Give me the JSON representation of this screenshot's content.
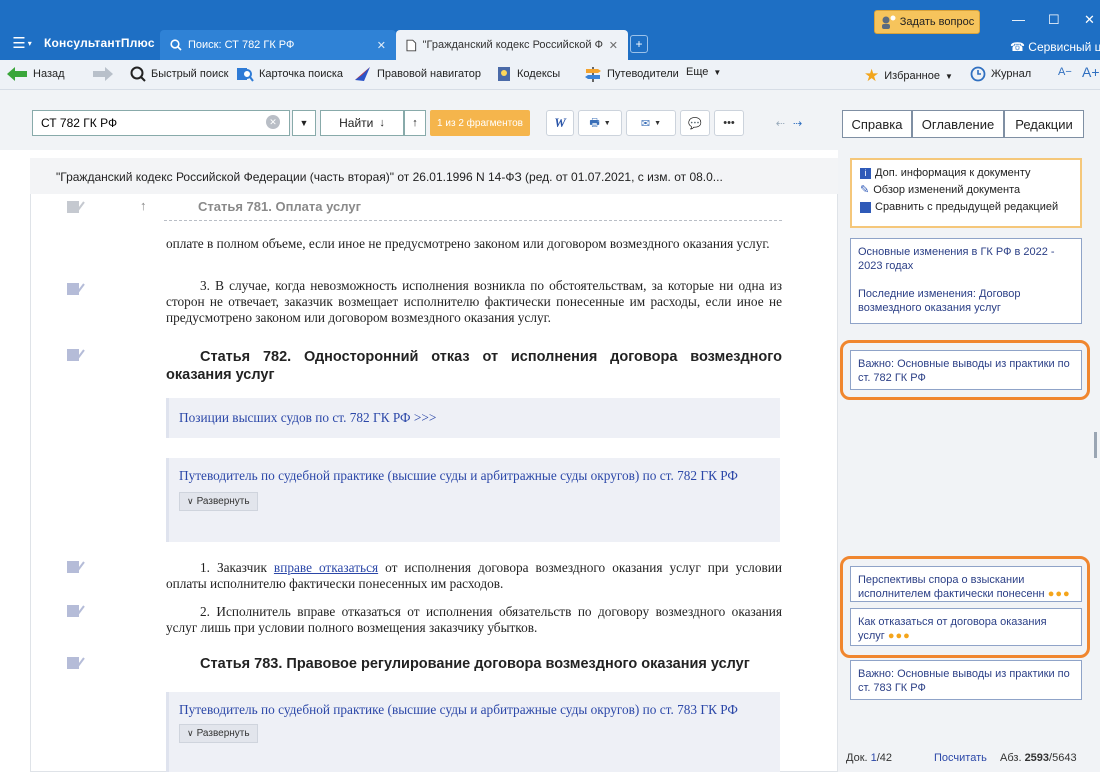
{
  "app": {
    "brand": "КонсультантПлюс",
    "ask_button": "Задать вопрос",
    "service": "Сервисный цен"
  },
  "tabs": [
    {
      "label": "Поиск: СТ 782 ГК РФ",
      "active": false
    },
    {
      "label": "\"Гражданский кодекс Российской Фе",
      "active": true
    }
  ],
  "toolbar": {
    "back": "Назад",
    "quick_search": "Быстрый поиск",
    "search_card": "Карточка поиска",
    "legal_navigator": "Правовой навигатор",
    "codes": "Кодексы",
    "guides": "Путеводители",
    "more": "Еще",
    "favorites": "Избранное",
    "journal": "Журнал",
    "font_minus": "A−",
    "font_plus": "A+"
  },
  "search": {
    "value": "СТ 782 ГК РФ",
    "find_label": "Найти",
    "fragments": "1 из 2 фрагментов"
  },
  "right_tabs": [
    "Справка",
    "Оглавление",
    "Редакции"
  ],
  "document": {
    "title": "\"Гражданский кодекс Российской Федерации (часть вторая)\" от 26.01.1996 N 14-ФЗ (ред. от 01.07.2021, с изм. от 08.0...",
    "art781_heading": "Статья 781. Оплата услуг",
    "para_781_end": "оплате в полном объеме, если иное не предусмотрено законом или договором возмездного оказания услуг.",
    "para_781_3": "3. В случае, когда невозможность исполнения возникла по обстоятельствам, за которые ни одна из сторон не отвечает, заказчик возмещает исполнителю фактически понесенные им расходы, если иное не предусмотрено законом или договором возмездного оказания услуг.",
    "art782_heading": "Статья 782. Односторонний отказ от исполнения договора возмездного оказания услуг",
    "box1_link": "Позиции высших судов по ст. 782 ГК РФ >>>",
    "box2_link": "Путеводитель по судебной практике (высшие суды и арбитражные суды округов) по ст. 782 ГК РФ",
    "expand_label": "Развернуть",
    "para_782_1_pre": "1. Заказчик ",
    "para_782_1_link": "вправе отказаться",
    "para_782_1_post": " от исполнения договора возмездного оказания услуг при условии оплаты исполнителю фактически понесенных им расходов.",
    "para_782_2": "2. Исполнитель вправе отказаться от исполнения обязательств по договору возмездного оказания услуг лишь при условии полного возмещения заказчику убытков.",
    "art783_heading": "Статья 783. Правовое регулирование договора возмездного оказания услуг",
    "box3_link": "Путеводитель по судебной практике (высшие суды и арбитражные суды округов) по ст. 783 ГК РФ"
  },
  "right_panel": {
    "info_links": [
      "Доп. информация к документу",
      "Обзор изменений документа",
      "Сравнить с предыдущей редакцией"
    ],
    "changes_1": "Основные изменения в ГК РФ в 2022 - 2023 годах",
    "changes_2": "Последние изменения: Договор возмездного оказания услуг",
    "important_782": "Важно: Основные выводы из практики по ст. 782 ГК РФ",
    "dispute": "Перспективы спора о взыскании исполнителем фактически понесенн",
    "refuse": "Как отказаться от договора оказания услуг",
    "important_783": "Важно: Основные выводы из практики по ст. 783 ГК РФ"
  },
  "status": {
    "doc_label": "Док.",
    "doc_pos": "1",
    "doc_total": "/42",
    "count": "Посчитать",
    "abz_label": "Абз.",
    "abz_pos": "2593",
    "abz_total": "/5643"
  }
}
